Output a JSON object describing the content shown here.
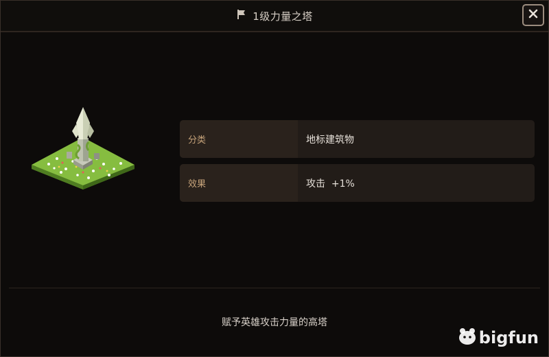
{
  "dialog": {
    "title": "1级力量之塔",
    "icons": {
      "title": "flag-icon",
      "close": "close-icon"
    }
  },
  "info": {
    "rows": [
      {
        "label": "分类",
        "value": "地标建筑物"
      },
      {
        "label": "效果",
        "value": "攻击  +1%"
      }
    ]
  },
  "description": "赋予英雄攻击力量的高塔",
  "watermark": {
    "text": "bigfun"
  },
  "colors": {
    "background": "#0d0b0a",
    "row_background": "#221c18",
    "label_text": "#c6a37a",
    "value_text": "#e6e0d9",
    "close_border": "#9c8d7f",
    "grass": "#7fb33a"
  }
}
